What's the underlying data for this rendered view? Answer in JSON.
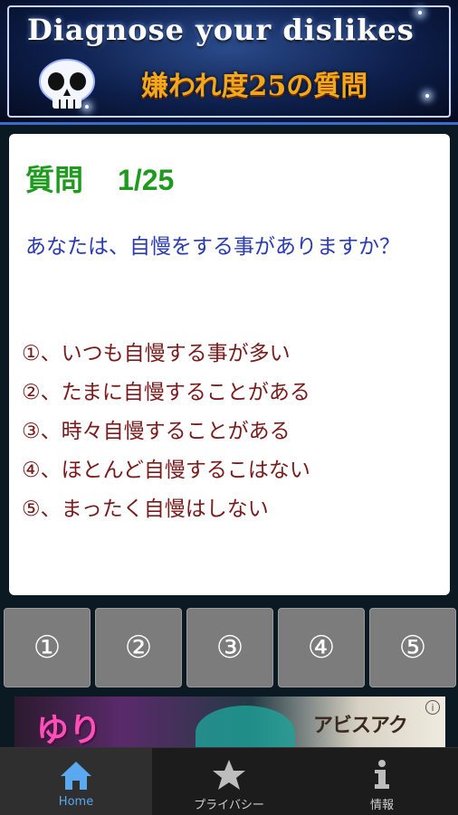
{
  "header": {
    "title": "Diagnose your dislikes",
    "subtitle": "嫌われ度25の質問"
  },
  "question": {
    "label": "質問",
    "progress": "1/25",
    "text": "あなたは、自慢をする事がありますか？",
    "options": [
      "①、いつも自慢する事が多い",
      "②、たまに自慢することがある",
      "③、時々自慢することがある",
      "④、ほとんど自慢するこはない",
      "⑤、まったく自慢はしない"
    ]
  },
  "answers": [
    "①",
    "②",
    "③",
    "④",
    "⑤"
  ],
  "ad": {
    "title": "アビスアク",
    "info": "i"
  },
  "nav": {
    "items": [
      {
        "label": "Home",
        "icon": "home-icon",
        "active": true
      },
      {
        "label": "プライバシー",
        "icon": "star-icon",
        "active": false
      },
      {
        "label": "情報",
        "icon": "info-icon",
        "active": false
      }
    ]
  },
  "colors": {
    "heading": "#1f9a1f",
    "question": "#2a3bb0",
    "option": "#7a1a1a",
    "nav_active": "#5aa8f0"
  }
}
